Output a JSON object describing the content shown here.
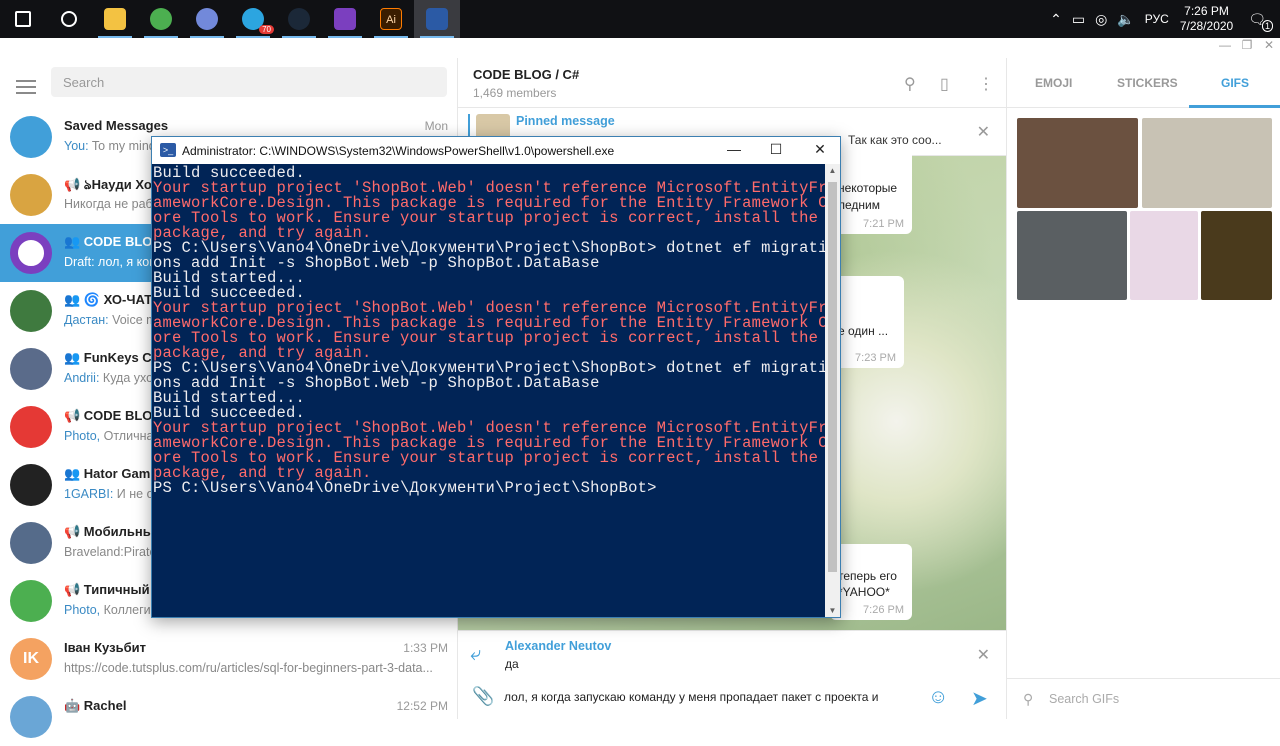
{
  "taskbar": {
    "apps": [
      {
        "name": "start-button",
        "icon": "windows-logo",
        "color": "#ffffff"
      },
      {
        "name": "search-button",
        "icon": "search-icon",
        "color": "#ffffff"
      },
      {
        "name": "file-explorer",
        "icon": "folder-icon",
        "color": "#f3c242"
      },
      {
        "name": "chrome",
        "icon": "chrome-icon",
        "color": "#4caf50"
      },
      {
        "name": "discord",
        "icon": "discord-icon",
        "color": "#7289da"
      },
      {
        "name": "telegram",
        "icon": "telegram-icon",
        "color": "#2ca5e0",
        "badge": "70"
      },
      {
        "name": "steam",
        "icon": "steam-icon",
        "color": "#1b2838"
      },
      {
        "name": "visual-studio",
        "icon": "visual-studio-icon",
        "color": "#7b3fbf"
      },
      {
        "name": "illustrator",
        "icon": "illustrator-icon",
        "color": "#ff7c00",
        "label": "Ai"
      },
      {
        "name": "powershell",
        "icon": "powershell-icon",
        "color": "#2b5aa5",
        "active": true
      }
    ],
    "tray": {
      "lang": "РУС",
      "time": "7:26 PM",
      "date": "7/28/2020",
      "notif_count": "1"
    }
  },
  "left": {
    "search_placeholder": "Search",
    "chats": [
      {
        "name": "Saved Messages",
        "who": "You:",
        "preview": " To my mind",
        "time": "Mon",
        "color": "#419fd9",
        "avatar_icon": "bookmark-icon"
      },
      {
        "name": "📢 ঌHayди Хо",
        "who": "",
        "preview": "Никогда не работ",
        "time": "",
        "color": "#d9a441",
        "avatar_icon": "fox-avatar"
      },
      {
        "name": "👥 CODE BLOG / C#",
        "who": "Draft:",
        "preview": " лол, я когда",
        "time": "",
        "color": "#7b3fbf",
        "avatar_icon": "code-blog-logo",
        "selected": true
      },
      {
        "name": "👥 🌀 ХО-ЧАТ",
        "who": "Дастан:",
        "preview": " Voice m",
        "time": "",
        "color": "#3f7a3f",
        "avatar_icon": "lion-avatar"
      },
      {
        "name": "👥 FunKeys Chat",
        "who": "Andrii:",
        "preview": " Куда ухо",
        "time": "",
        "color": "#5a6b8a",
        "avatar_icon": "funkeys-avatar"
      },
      {
        "name": "📢 CODE BLOG",
        "who": "Photo,",
        "preview": " Отличная",
        "time": "",
        "color": "#e53935",
        "avatar_icon": "code-blog-red-logo"
      },
      {
        "name": "👥 Hator Gaming",
        "who": "1GARBI:",
        "preview": " И не от",
        "time": "",
        "color": "#222222",
        "avatar_icon": "hator-logo"
      },
      {
        "name": "📢 Мобильные",
        "who": "",
        "preview": "Braveland:Pirate",
        "time": "",
        "color": "#556b8a",
        "avatar_icon": "game-avatar"
      },
      {
        "name": "📢 Типичный",
        "who": "Photo,",
        "preview": " Коллеги, как насчёт",
        "time": "",
        "color": "#4caf50",
        "avatar_icon": "cartoon-avatar"
      },
      {
        "name": "Іван Кузьбит",
        "who": "",
        "preview": "https://code.tutsplus.com/ru/articles/sql-for-beginners-part-3-data...",
        "time": "1:33 PM",
        "color": "#f4a261",
        "avatar_initials": "IK"
      },
      {
        "name": "🤖 Rachel",
        "who": "",
        "preview": "",
        "time": "12:52 PM",
        "color": "#6aa6d6",
        "avatar_icon": "rachel-avatar"
      }
    ]
  },
  "chat": {
    "title": "CODE BLOG / C#",
    "members": "1,469 members",
    "pinned_label": "Pinned message",
    "pinned_text": "Так как это соо...",
    "bubbles": [
      {
        "text": "некоторые\nледним",
        "time": "7:21 PM"
      },
      {
        "text": "е один ...",
        "time": "7:23 PM"
      },
      {
        "text": "теперь его\n*YAHOO*",
        "time": "7:26 PM"
      }
    ],
    "reply_name": "Alexander Neutov",
    "reply_text": "да",
    "compose_text": "лол, я когда запускаю команду у меня пропадает пакет с проекта и"
  },
  "right": {
    "tabs": [
      "EMOJI",
      "STICKERS",
      "GIFS"
    ],
    "active_tab": "GIFS",
    "search_placeholder": "Search GIFs",
    "gif_colors": [
      "#6b5140",
      "#c8c2b4",
      "#5a5f62",
      "#e9d8e6",
      "#4a3a1c"
    ]
  },
  "powershell": {
    "title": "Administrator: C:\\WINDOWS\\System32\\WindowsPowerShell\\v1.0\\powershell.exe",
    "lines": [
      {
        "t": "Build succeeded.",
        "err": false
      },
      {
        "t": "Your startup project 'ShopBot.Web' doesn't reference Microsoft.EntityFr",
        "err": true
      },
      {
        "t": "ameworkCore.Design. This package is required for the Entity Framework C",
        "err": true
      },
      {
        "t": "ore Tools to work. Ensure your startup project is correct, install the",
        "err": true
      },
      {
        "t": "package, and try again.",
        "err": true
      },
      {
        "t": "PS C:\\Users\\Vano4\\OneDrive\\Документи\\Project\\ShopBot> dotnet ef migrati",
        "err": false
      },
      {
        "t": "ons add Init -s ShopBot.Web -p ShopBot.DataBase",
        "err": false
      },
      {
        "t": "Build started...",
        "err": false
      },
      {
        "t": "Build succeeded.",
        "err": false
      },
      {
        "t": "Your startup project 'ShopBot.Web' doesn't reference Microsoft.EntityFr",
        "err": true
      },
      {
        "t": "ameworkCore.Design. This package is required for the Entity Framework C",
        "err": true
      },
      {
        "t": "ore Tools to work. Ensure your startup project is correct, install the",
        "err": true
      },
      {
        "t": "package, and try again.",
        "err": true
      },
      {
        "t": "PS C:\\Users\\Vano4\\OneDrive\\Документи\\Project\\ShopBot> dotnet ef migrati",
        "err": false
      },
      {
        "t": "ons add Init -s ShopBot.Web -p ShopBot.DataBase",
        "err": false
      },
      {
        "t": "Build started...",
        "err": false
      },
      {
        "t": "Build succeeded.",
        "err": false
      },
      {
        "t": "Your startup project 'ShopBot.Web' doesn't reference Microsoft.EntityFr",
        "err": true
      },
      {
        "t": "ameworkCore.Design. This package is required for the Entity Framework C",
        "err": true
      },
      {
        "t": "ore Tools to work. Ensure your startup project is correct, install the",
        "err": true
      },
      {
        "t": "package, and try again.",
        "err": true
      },
      {
        "t": "PS C:\\Users\\Vano4\\OneDrive\\Документи\\Project\\ShopBot>",
        "err": false
      }
    ]
  }
}
